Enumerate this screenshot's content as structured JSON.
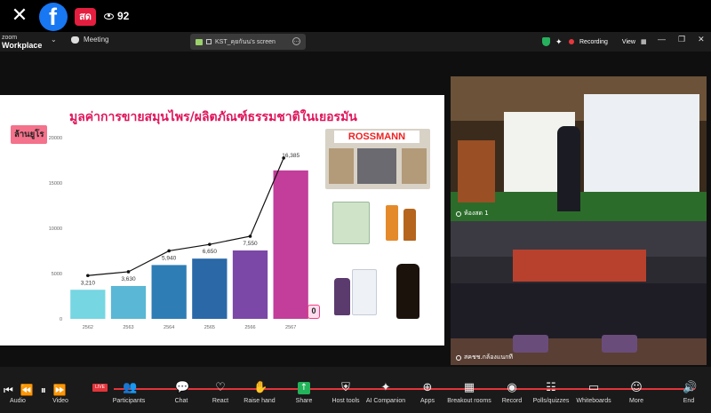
{
  "facebook": {
    "live_label": "สด",
    "viewer_count": "92",
    "logo_letter": "f"
  },
  "zoom_bar": {
    "logo_top": "zoom",
    "logo_bottom": "Workplace",
    "meeting_tab": "Meeting",
    "screen_tab": "KST_คุยกันน's screen",
    "recording_label": "Recording",
    "view_label": "View"
  },
  "slide": {
    "title": "มูลค่าการขายสมุนไพร/ผลิตภัณฑ์ธรรมชาติในเยอรมัน",
    "unit_badge": "ล้านยูโร",
    "zero_badge": "0",
    "store_sign": "ROSSMANN"
  },
  "chart_data": {
    "type": "bar",
    "categories": [
      "2562",
      "2563",
      "2564",
      "2565",
      "2566",
      "2567"
    ],
    "values": [
      3210,
      3630,
      5940,
      6650,
      7550,
      16385
    ],
    "value_labels": [
      "3,210",
      "3,630",
      "5,940",
      "6,650",
      "7,550",
      "16,385"
    ],
    "line_overlay": true,
    "bar_colors": [
      "#76d6e2",
      "#5ab7d5",
      "#2e7db5",
      "#2a68a8",
      "#7b48a7",
      "#c23e9a"
    ],
    "yticks": [
      "0",
      "5000",
      "10000",
      "15000",
      "20000"
    ],
    "ylim": [
      0,
      20000
    ],
    "grid": false,
    "legend": "none"
  },
  "videos": {
    "top_label": "ห้องสด 1",
    "bottom_label": "สคชช.กล้องแนกที"
  },
  "toolbar": {
    "live_tag": "LIVE",
    "items": [
      {
        "label": "Audio"
      },
      {
        "label": "Video"
      },
      {
        "label": "Participants"
      },
      {
        "label": "Chat"
      },
      {
        "label": "React"
      },
      {
        "label": "Raise hand"
      },
      {
        "label": "Share"
      },
      {
        "label": "Host tools"
      },
      {
        "label": "AI Companion"
      },
      {
        "label": "Apps"
      },
      {
        "label": "Breakout rooms"
      },
      {
        "label": "Record"
      },
      {
        "label": "Polls/quizzes"
      },
      {
        "label": "Whiteboards"
      },
      {
        "label": "More"
      },
      {
        "label": "End"
      }
    ]
  },
  "colors": {
    "fb_blue": "#1877f2",
    "live_red": "#e41e3f",
    "title_pink": "#e0165c",
    "share_green": "#23b35a"
  }
}
